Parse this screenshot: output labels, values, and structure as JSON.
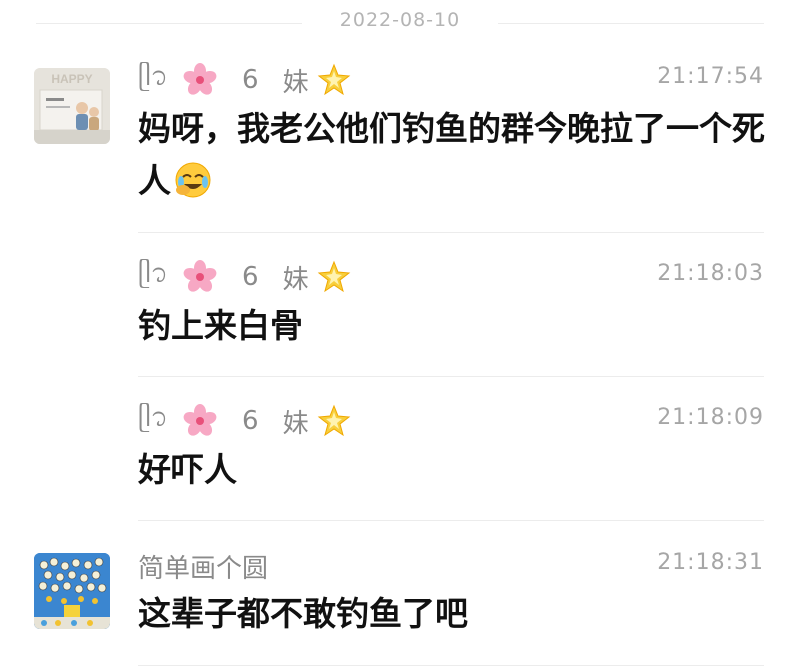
{
  "date_separator": "2022-08-10",
  "messages": [
    {
      "sender_prefix": "ᥫ᭡",
      "sender_num": "6",
      "sender_mei": "妹",
      "time": "21:17:54",
      "text": "妈呀，我老公他们钓鱼的群今晚拉了一个死人",
      "text_emoji": "face-with-tears-icon",
      "show_avatar": true,
      "avatar_label": "HAPPY"
    },
    {
      "sender_prefix": "ᥫ᭡",
      "sender_num": "6",
      "sender_mei": "妹",
      "time": "21:18:03",
      "text": "钓上来白骨"
    },
    {
      "sender_prefix": "ᥫ᭡",
      "sender_num": "6",
      "sender_mei": "妹",
      "time": "21:18:09",
      "text": "好吓人"
    },
    {
      "sender_name": "简单画个圆",
      "time": "21:18:31",
      "text": "这辈子都不敢钓鱼了吧",
      "show_avatar": true
    }
  ],
  "colors": {
    "name": "#8a8a8a",
    "time": "#a6a6a6",
    "text": "#111111",
    "divider": "#ececec"
  }
}
